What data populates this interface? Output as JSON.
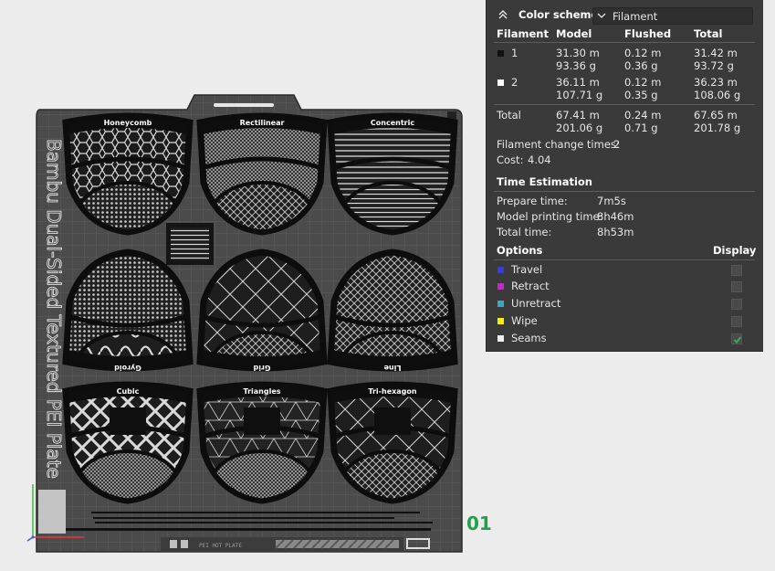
{
  "panel": {
    "color_scheme_label": "Color scheme",
    "color_scheme_value": "Filament",
    "table": {
      "headers": [
        "Filament",
        "Model",
        "Flushed",
        "Total"
      ],
      "rows": [
        {
          "id": "1",
          "swatch": "#111111",
          "model": [
            "31.30 m",
            "93.36 g"
          ],
          "flushed": [
            "0.12 m",
            "0.36 g"
          ],
          "total": [
            "31.42 m",
            "93.72 g"
          ]
        },
        {
          "id": "2",
          "swatch": "#ffffff",
          "model": [
            "36.11 m",
            "107.71 g"
          ],
          "flushed": [
            "0.12 m",
            "0.35 g"
          ],
          "total": [
            "36.23 m",
            "108.06 g"
          ]
        }
      ],
      "total_row": {
        "label": "Total",
        "model": [
          "67.41 m",
          "201.06 g"
        ],
        "flushed": [
          "0.24 m",
          "0.71 g"
        ],
        "total": [
          "67.65 m",
          "201.78 g"
        ]
      }
    },
    "filament_change": {
      "label": "Filament change times:",
      "value": "2"
    },
    "cost": {
      "label": "Cost:",
      "value": "4.04"
    },
    "time_estimation": {
      "title": "Time Estimation",
      "rows": [
        {
          "label": "Prepare time:",
          "value": "7m5s"
        },
        {
          "label": "Model printing time:",
          "value": "8h46m"
        },
        {
          "label": "Total time:",
          "value": "8h53m"
        }
      ]
    },
    "options": {
      "title": "Options",
      "display_label": "Display",
      "items": [
        {
          "label": "Travel",
          "color": "#3b3bd6",
          "checked": false
        },
        {
          "label": "Retract",
          "color": "#c02cc0",
          "checked": false
        },
        {
          "label": "Unretract",
          "color": "#3aa6c8",
          "checked": false
        },
        {
          "label": "Wipe",
          "color": "#f2f200",
          "checked": false
        },
        {
          "label": "Seams",
          "color": "#eeeeee",
          "checked": true
        }
      ]
    }
  },
  "plate": {
    "side_text": "Bambu Dual-Sided Textured PEI Plate",
    "plate_number": "01",
    "patterns": [
      "Honeycomb",
      "Rectilinear",
      "Concentric",
      "Gyroid",
      "Grid",
      "Line",
      "Cubic",
      "Triangles",
      "Tri-hexagon"
    ]
  },
  "colors": {
    "panel_bg": "#3a3a3a",
    "plate_bg": "#4a4a4a",
    "plate_number": "#22a04b",
    "seam_check": "#35b35a"
  }
}
